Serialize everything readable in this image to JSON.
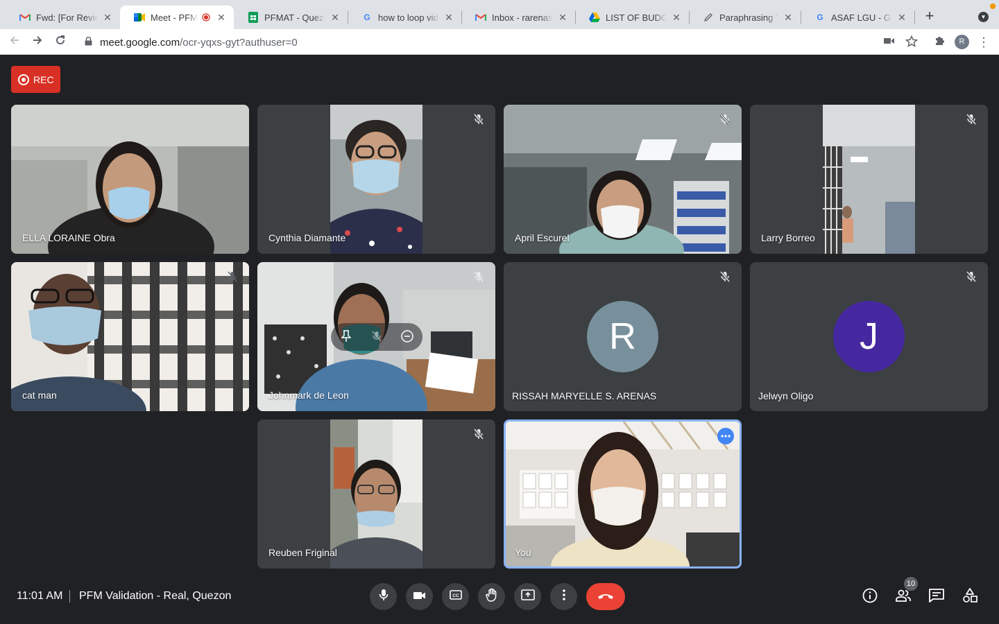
{
  "browser": {
    "tabs": [
      {
        "title": "Fwd: [For Review]",
        "favicon": "gmail-icon",
        "active": false
      },
      {
        "title": "Meet - PFM V",
        "favicon": "meet-icon",
        "active": true,
        "recording": true
      },
      {
        "title": "PFMAT - Quezon",
        "favicon": "sheets-icon",
        "active": false
      },
      {
        "title": "how to loop video",
        "favicon": "google-icon",
        "active": false
      },
      {
        "title": "Inbox - rarenas@",
        "favicon": "gmail-icon",
        "active": false
      },
      {
        "title": "LIST OF BUDGET",
        "favicon": "drive-icon",
        "active": false
      },
      {
        "title": "Paraphrasing Too",
        "favicon": "pen-icon",
        "active": false
      },
      {
        "title": "ASAF LGU - Goog",
        "favicon": "google-icon",
        "active": false
      }
    ],
    "url": {
      "host": "meet.google.com",
      "path": "/ocr-yqxs-gyt?authuser=0"
    },
    "profile_initial": "R"
  },
  "meet": {
    "rec_label": "REC",
    "participants": [
      {
        "name": "ELLA LORAINE Obra",
        "muted": false
      },
      {
        "name": "Cynthia Diamante",
        "muted": true
      },
      {
        "name": "April Escurel",
        "muted": true
      },
      {
        "name": "Larry Borreo",
        "muted": true
      },
      {
        "name": "cat man",
        "muted": true
      },
      {
        "name": "Johnmark de Leon",
        "muted": true
      },
      {
        "name": "RISSAH MARYELLE S. ARENAS",
        "muted": true,
        "initial": "R",
        "avatar_color": "#78909c"
      },
      {
        "name": "Jelwyn Oligo",
        "muted": true,
        "initial": "J",
        "avatar_color": "#4527a0"
      },
      {
        "name": "Reuben Friginal",
        "muted": true
      },
      {
        "name": "You",
        "muted": false,
        "self": true
      }
    ],
    "bottom_bar": {
      "time": "11:01 AM",
      "meeting_title": "PFM Validation - Real, Quezon",
      "people_count": "10"
    }
  },
  "colors": {
    "accent": "#1a73e8",
    "leave": "#ea4335",
    "rec": "#d93025",
    "background": "#202124"
  }
}
